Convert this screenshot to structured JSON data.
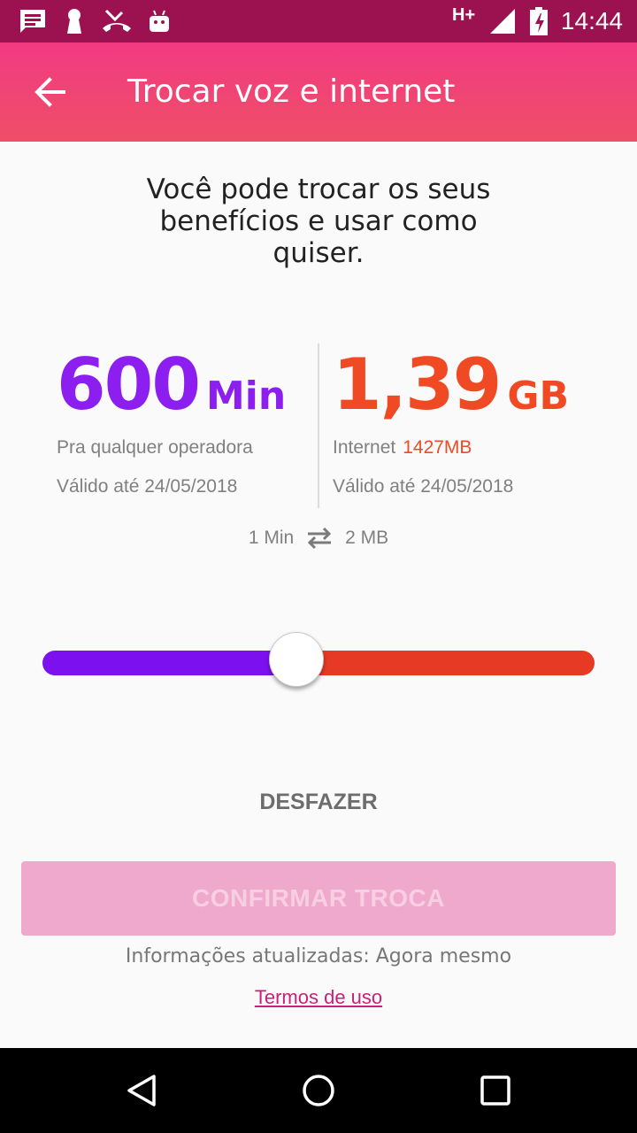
{
  "status_bar": {
    "time": "14:44",
    "network": "H+",
    "icons": [
      "message-icon",
      "keyhole-icon",
      "missed-call-icon",
      "android-icon",
      "signal-icon",
      "battery-charging-icon"
    ],
    "background": "#9c114f"
  },
  "app_bar": {
    "title": "Trocar voz e internet",
    "back_icon": "arrow-back-icon"
  },
  "intro": "Você pode trocar os seus benefícios e usar como quiser.",
  "voice": {
    "amount": "600",
    "unit": "Min",
    "description": "Pra qualquer operadora",
    "validity": "Válido até 24/05/2018",
    "color": "#8c1ef0"
  },
  "data": {
    "amount": "1,39",
    "unit": "GB",
    "description": "Internet",
    "mb": "1427MB",
    "validity": "Válido até 24/05/2018",
    "color": "#f04a24"
  },
  "rate": {
    "left": "1 Min",
    "right": "2 MB",
    "icon": "swap-horizontal-icon"
  },
  "slider": {
    "value": 0.46
  },
  "undo_label": "DESFAZER",
  "confirm_label": "CONFIRMAR TROCA",
  "updated_text": "Informações atualizadas: Agora mesmo",
  "terms_label": "Termos de uso",
  "nav": [
    "back-nav-icon",
    "home-nav-icon",
    "recents-nav-icon"
  ]
}
